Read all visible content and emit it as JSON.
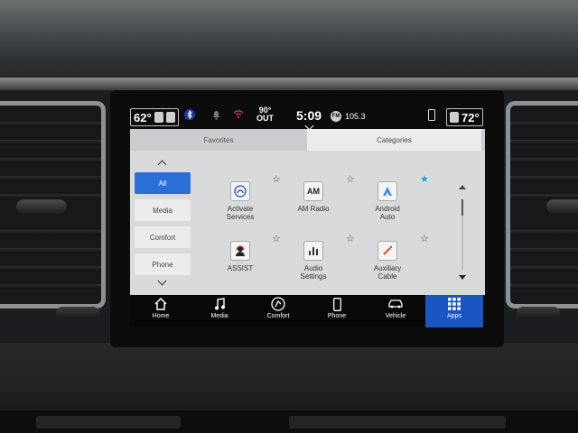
{
  "status": {
    "driver_temp": "62°",
    "outside_temp": "90°",
    "outside_label": "OUT",
    "time": "5:09",
    "radio_band": "FM",
    "radio_station": "105.3",
    "passenger_temp": "72°"
  },
  "tabs": {
    "favorites": "Favorites",
    "categories": "Categories"
  },
  "categories": [
    "All",
    "Media",
    "Comfort",
    "Phone"
  ],
  "selected_category": "All",
  "apps": [
    {
      "label_line1": "Activate",
      "label_line2": "Services",
      "icon": "activate-services-icon",
      "favorite": false
    },
    {
      "label_line1": "AM Radio",
      "label_line2": "",
      "icon": "am-radio-icon",
      "icon_text": "AM",
      "favorite": false
    },
    {
      "label_line1": "Android",
      "label_line2": "Auto",
      "icon": "android-auto-icon",
      "favorite": true
    },
    {
      "label_line1": "ASSIST",
      "label_line2": "",
      "icon": "assist-icon",
      "favorite": false
    },
    {
      "label_line1": "Audio",
      "label_line2": "Settings",
      "icon": "audio-settings-icon",
      "favorite": false
    },
    {
      "label_line1": "Auxiliary",
      "label_line2": "Cable",
      "icon": "auxiliary-cable-icon",
      "favorite": false
    }
  ],
  "scroll_position": 0.0,
  "nav": [
    {
      "label": "Home",
      "icon": "home-icon"
    },
    {
      "label": "Media",
      "icon": "music-note-icon"
    },
    {
      "label": "Comfort",
      "icon": "comfort-icon"
    },
    {
      "label": "Phone",
      "icon": "phone-icon"
    },
    {
      "label": "Vehicle",
      "icon": "vehicle-icon"
    },
    {
      "label": "Apps",
      "icon": "apps-grid-icon"
    }
  ],
  "selected_nav": "Apps",
  "colors": {
    "accent": "#1a55c4",
    "favorite_star": "#1ea3c8",
    "selected_category": "#2a6fd6"
  }
}
